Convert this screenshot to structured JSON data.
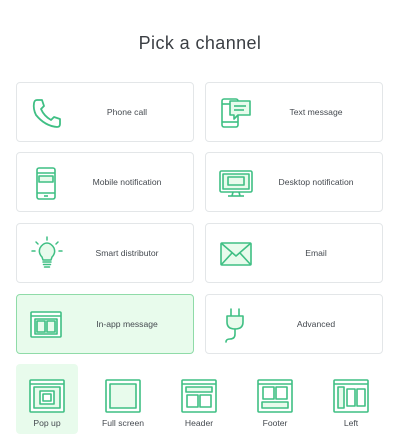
{
  "page_title": "Pick a channel",
  "accent_color": "#3fbf84",
  "selected_channel": "In-app message",
  "selected_layout": "Pop up",
  "channels": [
    {
      "label": "Phone call",
      "icon": "phone-icon"
    },
    {
      "label": "Text message",
      "icon": "text-message-icon"
    },
    {
      "label": "Mobile notification",
      "icon": "mobile-icon"
    },
    {
      "label": "Desktop notification",
      "icon": "desktop-icon"
    },
    {
      "label": "Smart distributor",
      "icon": "lightbulb-icon"
    },
    {
      "label": "Email",
      "icon": "envelope-icon"
    },
    {
      "label": "In-app message",
      "icon": "in-app-icon"
    },
    {
      "label": "Advanced",
      "icon": "plug-icon"
    }
  ],
  "layouts": [
    {
      "label": "Pop up",
      "icon": "popup-layout-icon"
    },
    {
      "label": "Full screen",
      "icon": "fullscreen-layout-icon"
    },
    {
      "label": "Header",
      "icon": "header-layout-icon"
    },
    {
      "label": "Footer",
      "icon": "footer-layout-icon"
    },
    {
      "label": "Left",
      "icon": "left-layout-icon"
    }
  ]
}
